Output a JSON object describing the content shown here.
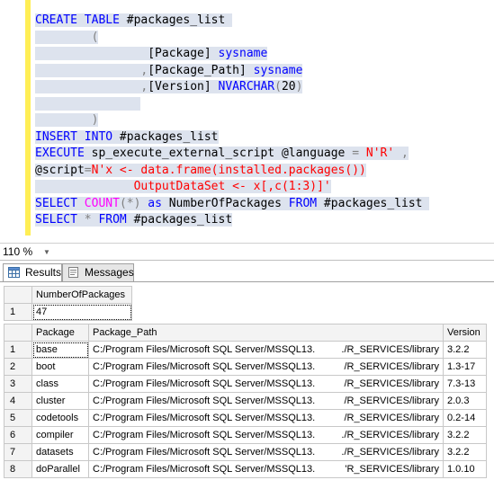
{
  "editor": {
    "lines": [
      [
        {
          "t": "CREATE TABLE",
          "c": "kw"
        },
        {
          "t": " #packages_list ",
          "c": ""
        }
      ],
      [
        {
          "t": "        ",
          "c": ""
        },
        {
          "t": "(",
          "c": "op"
        }
      ],
      [
        {
          "t": "                ",
          "c": ""
        },
        {
          "t": "[Package] ",
          "c": ""
        },
        {
          "t": "sysname",
          "c": "kw"
        }
      ],
      [
        {
          "t": "               ",
          "c": ""
        },
        {
          "t": ",",
          "c": "op"
        },
        {
          "t": "[Package_Path] ",
          "c": ""
        },
        {
          "t": "sysname",
          "c": "kw"
        }
      ],
      [
        {
          "t": "               ",
          "c": ""
        },
        {
          "t": ",",
          "c": "op"
        },
        {
          "t": "[Version] ",
          "c": ""
        },
        {
          "t": "NVARCHAR",
          "c": "kw"
        },
        {
          "t": "(",
          "c": "op"
        },
        {
          "t": "20",
          "c": ""
        },
        {
          "t": ")",
          "c": "op"
        }
      ],
      [
        {
          "t": "               ",
          "c": ""
        }
      ],
      [
        {
          "t": "        ",
          "c": ""
        },
        {
          "t": ")",
          "c": "op"
        }
      ],
      [
        {
          "t": "INSERT INTO",
          "c": "kw"
        },
        {
          "t": " #packages_list",
          "c": ""
        }
      ],
      [
        {
          "t": "EXECUTE",
          "c": "kw"
        },
        {
          "t": " sp_execute_external_script @language ",
          "c": ""
        },
        {
          "t": "=",
          "c": "op"
        },
        {
          "t": " N'R'",
          "c": "str"
        },
        {
          "t": " ",
          "c": ""
        },
        {
          "t": ",",
          "c": "op"
        }
      ],
      [
        {
          "t": "@script",
          "c": ""
        },
        {
          "t": "=",
          "c": "op"
        },
        {
          "t": "N'x <- data.frame(installed.packages())",
          "c": "str"
        }
      ],
      [
        {
          "t": "              ",
          "c": ""
        },
        {
          "t": "OutputDataSet <- x[,c(1:3)]'",
          "c": "str"
        }
      ],
      [
        {
          "t": "SELECT",
          "c": "kw"
        },
        {
          "t": " ",
          "c": ""
        },
        {
          "t": "COUNT",
          "c": "fn"
        },
        {
          "t": "(",
          "c": "op"
        },
        {
          "t": "*",
          "c": "op"
        },
        {
          "t": ")",
          "c": "op"
        },
        {
          "t": " ",
          "c": ""
        },
        {
          "t": "as",
          "c": "kw"
        },
        {
          "t": " NumberOfPackages ",
          "c": ""
        },
        {
          "t": "FROM",
          "c": "kw"
        },
        {
          "t": " #packages_list ",
          "c": ""
        }
      ],
      [
        {
          "t": "SELECT",
          "c": "kw"
        },
        {
          "t": " ",
          "c": ""
        },
        {
          "t": "*",
          "c": "op"
        },
        {
          "t": " ",
          "c": ""
        },
        {
          "t": "FROM",
          "c": "kw"
        },
        {
          "t": " #packages_list",
          "c": ""
        }
      ]
    ]
  },
  "zoom": {
    "value": "110 %"
  },
  "tabs": {
    "results": "Results",
    "messages": "Messages"
  },
  "count_grid": {
    "header": "NumberOfPackages",
    "row_number": "1",
    "value": "47"
  },
  "packages_grid": {
    "headers": [
      "Package",
      "Package_Path",
      "Version"
    ],
    "rows": [
      {
        "n": "1",
        "package": "base",
        "path_a": "C:/Program Files/Microsoft SQL Server/MSSQL13.",
        "path_b": "./R_SERVICES/library",
        "version": "3.2.2"
      },
      {
        "n": "2",
        "package": "boot",
        "path_a": "C:/Program Files/Microsoft SQL Server/MSSQL13.",
        "path_b": "/R_SERVICES/library",
        "version": "1.3-17"
      },
      {
        "n": "3",
        "package": "class",
        "path_a": "C:/Program Files/Microsoft SQL Server/MSSQL13.",
        "path_b": "/R_SERVICES/library",
        "version": "7.3-13"
      },
      {
        "n": "4",
        "package": "cluster",
        "path_a": "C:/Program Files/Microsoft SQL Server/MSSQL13.",
        "path_b": "/R_SERVICES/library",
        "version": "2.0.3"
      },
      {
        "n": "5",
        "package": "codetools",
        "path_a": "C:/Program Files/Microsoft SQL Server/MSSQL13.",
        "path_b": "/R_SERVICES/library",
        "version": "0.2-14"
      },
      {
        "n": "6",
        "package": "compiler",
        "path_a": "C:/Program Files/Microsoft SQL Server/MSSQL13.",
        "path_b": "./R_SERVICES/library",
        "version": "3.2.2"
      },
      {
        "n": "7",
        "package": "datasets",
        "path_a": "C:/Program Files/Microsoft SQL Server/MSSQL13.",
        "path_b": "./R_SERVICES/library",
        "version": "3.2.2"
      },
      {
        "n": "8",
        "package": "doParallel",
        "path_a": "C:/Program Files/Microsoft SQL Server/MSSQL13.",
        "path_b": "'R_SERVICES/library",
        "version": "1.0.10"
      }
    ]
  }
}
